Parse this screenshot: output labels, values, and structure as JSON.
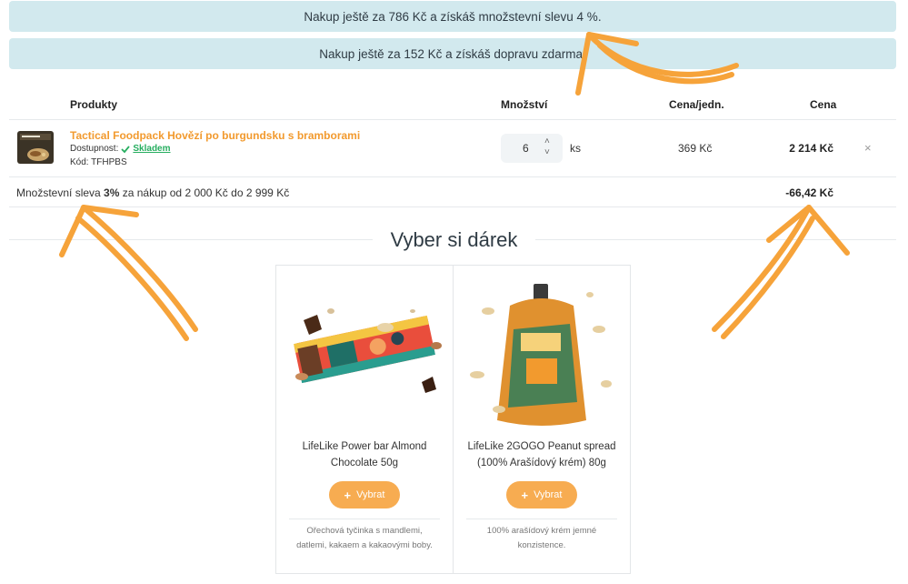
{
  "banners": {
    "discount": "Nakup ještě za 786 Kč a získáš množstevní slevu 4 %.",
    "shipping": "Nakup ještě za 152 Kč a získáš dopravu zdarma."
  },
  "table": {
    "headers": {
      "product": "Produkty",
      "quantity": "Množství",
      "unit_price": "Cena/jedn.",
      "price": "Cena"
    }
  },
  "cart_item": {
    "name": "Tactical Foodpack Hovězí po burgundsku s bramborami",
    "availability_label": "Dostupnost:",
    "availability_value": "Skladem",
    "code_label": "Kód: TFHPBS",
    "quantity": "6",
    "unit": "ks",
    "unit_price": "369 Kč",
    "total_price": "2 214 Kč"
  },
  "discount": {
    "prefix": "Množstevní sleva ",
    "percent": "3%",
    "suffix": " za nákup od 2 000 Kč do 2 999 Kč",
    "value": "-66,42 Kč"
  },
  "gifts": {
    "title": "Vyber si dárek",
    "items": [
      {
        "name_line1": "LifeLike Power bar Almond",
        "name_line2": "Chocolate 50g",
        "button": "Vybrat",
        "desc_line1": "Ořechová tyčinka s mandlemi,",
        "desc_line2": "datlemi, kakaem a kakaovými boby."
      },
      {
        "name_line1": "LifeLike 2GOGO Peanut spread",
        "name_line2": "(100% Arašídový krém) 80g",
        "button": "Vybrat",
        "desc_line1": "100% arašídový krém jemné",
        "desc_line2": "konzistence."
      }
    ]
  },
  "colors": {
    "accent_orange": "#f29a2e",
    "button_orange": "#f7ac51",
    "banner_bg": "#d2e9ee",
    "in_stock_green": "#27ae60"
  }
}
